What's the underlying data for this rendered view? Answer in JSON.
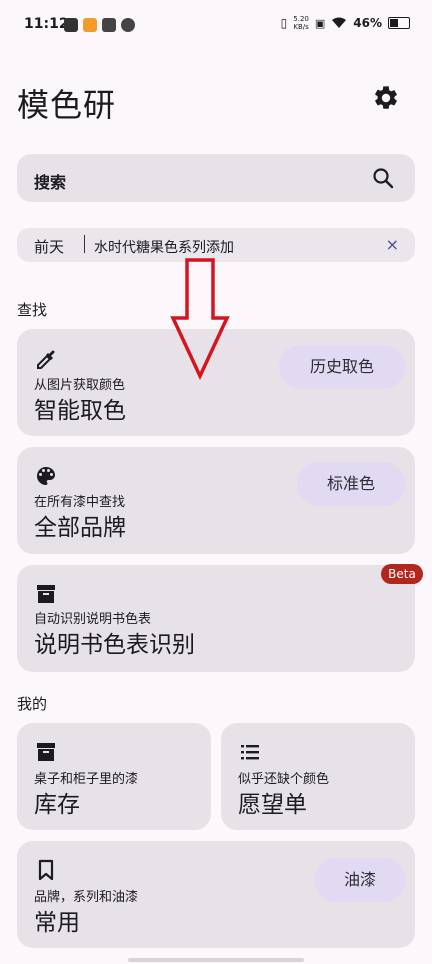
{
  "status_bar": {
    "time": "11:12",
    "net_speed_value": "5.20",
    "net_speed_unit": "KB/s",
    "battery": "46%",
    "battery_level": 0.46
  },
  "app": {
    "title": "模色研"
  },
  "search": {
    "label": "搜索"
  },
  "notice": {
    "date": "前天",
    "message": "水时代糖果色系列添加",
    "close": "×"
  },
  "sections": {
    "find": "查找",
    "mine": "我的"
  },
  "cards": {
    "smart_pick": {
      "subtitle": "从图片获取颜色",
      "title": "智能取色",
      "pill": "历史取色"
    },
    "all_brands": {
      "subtitle": "在所有漆中查找",
      "title": "全部品牌",
      "pill": "标准色"
    },
    "manual_scan": {
      "subtitle": "自动识别说明书色表",
      "title": "说明书色表识别",
      "badge": "Beta"
    },
    "inventory": {
      "subtitle": "桌子和柜子里的漆",
      "title": "库存"
    },
    "wishlist": {
      "subtitle": "似乎还缺个颜色",
      "title": "愿望单"
    },
    "common": {
      "subtitle": "品牌，系列和油漆",
      "title": "常用",
      "pill": "油漆"
    }
  },
  "colors": {
    "accent_pill": "#e2d9f2",
    "card_bg": "#e7e2e8",
    "beta_badge": "#b3261e",
    "annotation_arrow": "#d6141e"
  }
}
